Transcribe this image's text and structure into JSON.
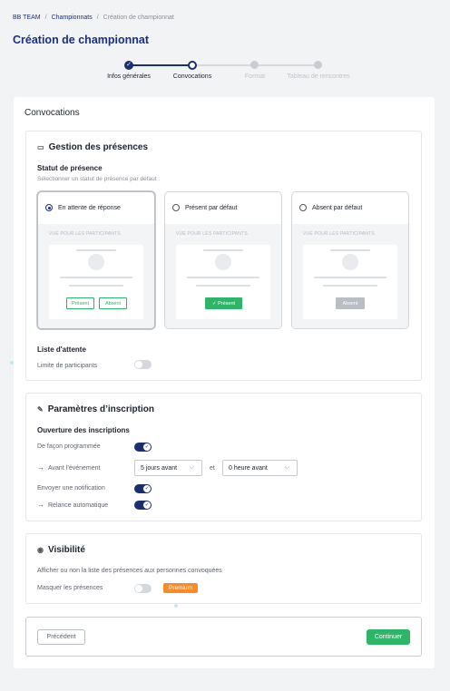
{
  "breadcrumb": [
    "BB TEAM",
    "/",
    "Championnats",
    "/",
    "Création de championnat"
  ],
  "page_title": "Création de championnat",
  "stepper": {
    "steps": [
      "Infos générales",
      "Convocations",
      "Format",
      "Tableau de rencontres"
    ]
  },
  "section_title": "Convocations",
  "presence": {
    "title": "Gestion des présences",
    "status_label": "Statut de présence",
    "status_hint": "Sélectionner un statut de présence par défaut :",
    "options": [
      {
        "label": "En attente de réponse",
        "view": "VUE POUR LES PARTICIPANTS",
        "btn1": "Présent",
        "btn2": "Absent"
      },
      {
        "label": "Présent par défaut",
        "view": "VUE POUR LES PARTICIPANTS",
        "btn1": "✓  Présent"
      },
      {
        "label": "Absent par défaut",
        "view": "VUE POUR LES PARTICIPANTS",
        "btn1": "Absent"
      }
    ],
    "waitlist_label": "Liste d'attente",
    "limit_label": "Limite de participants"
  },
  "inscription": {
    "title": "Paramètres d’inscription",
    "opening_label": "Ouverture des inscriptions",
    "scheduled_label": "De façon programmée",
    "before_event_label": "Avant l’événement",
    "select1": "5 jours avant",
    "and_label": "et",
    "select2": "0 heure avant",
    "notify_label": "Envoyer une notification",
    "relance_label": "Relance automatique"
  },
  "visibility": {
    "title": "Visibilité",
    "hint": "Afficher ou non la liste des présences aux personnes convoquées",
    "mask_label": "Masquer les présences",
    "badge": "Premium"
  },
  "footer": {
    "prev": "Précédent",
    "next": "Continuer"
  },
  "colors": {
    "primary": "#1a2f86",
    "success": "#2fb46a",
    "premium": "#f48c2c"
  }
}
